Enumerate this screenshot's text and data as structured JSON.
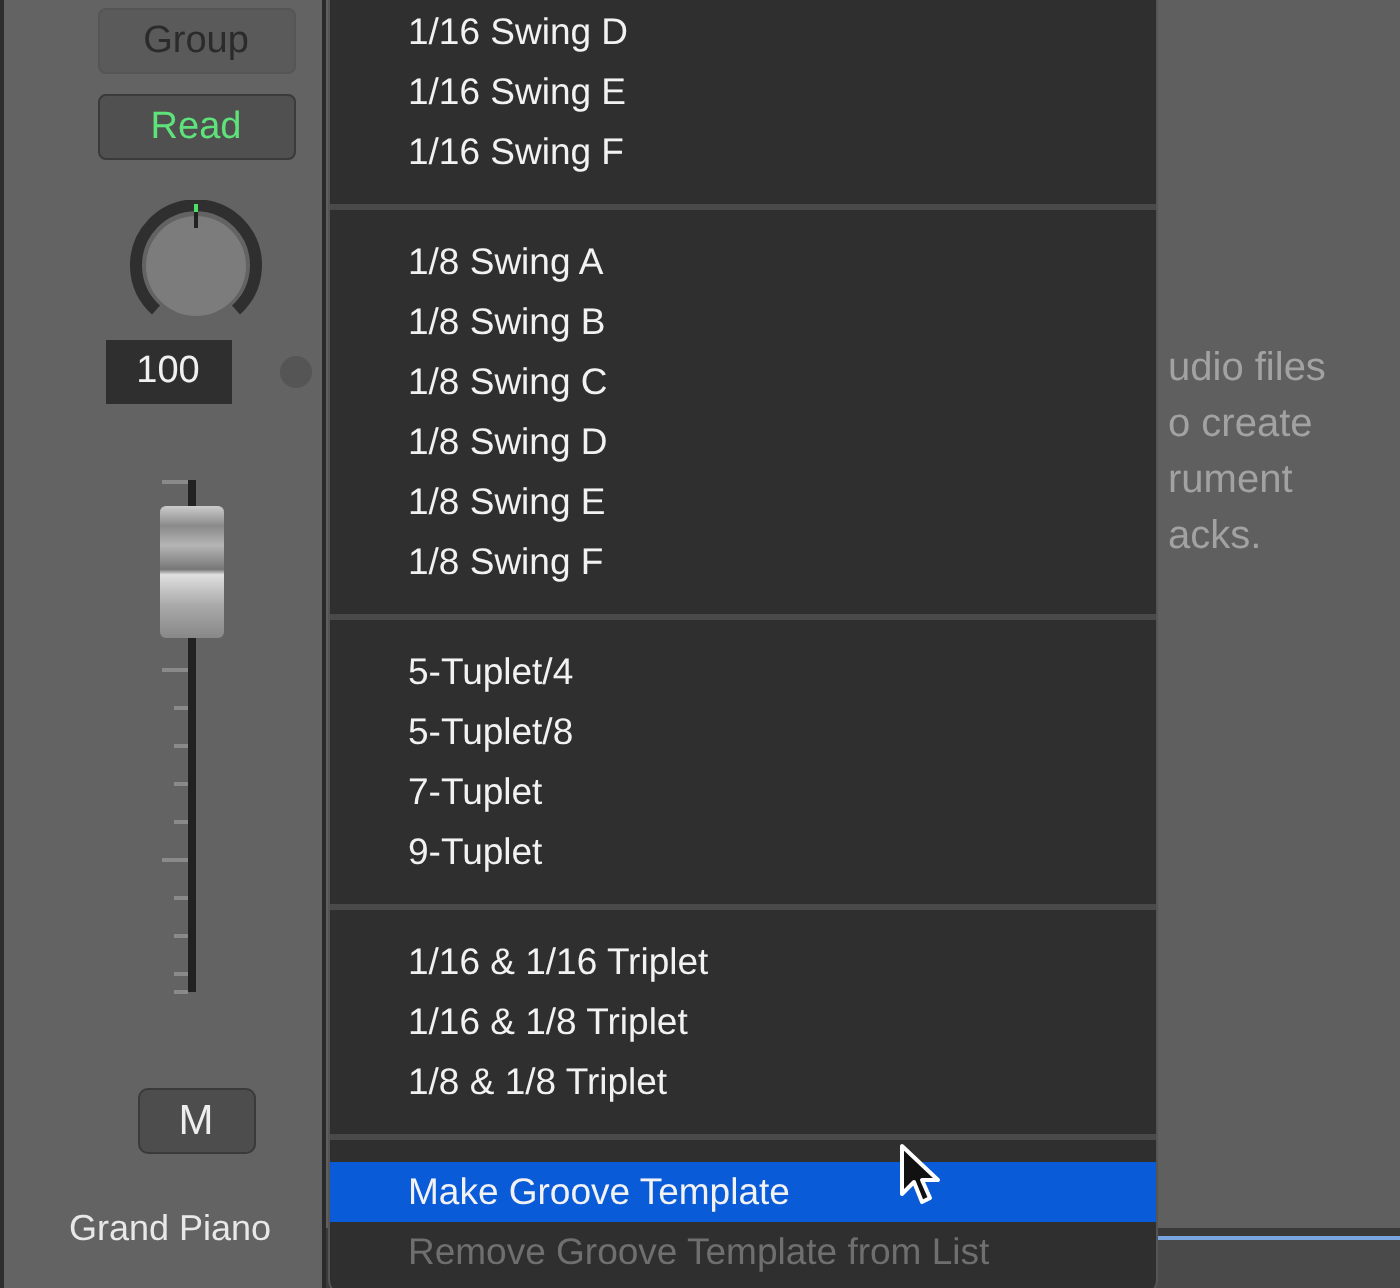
{
  "channel_strip": {
    "group_button": "Group",
    "automation_button": "Read",
    "pan_value": "100",
    "fader": {
      "level": 0.82
    },
    "mute_button": "M",
    "track_name": "Grand Piano"
  },
  "hint_text": [
    "udio files",
    "o create",
    "rument",
    "acks."
  ],
  "menu": {
    "sections": [
      [
        {
          "label": "1/16 Swing D",
          "selected": false,
          "disabled": false
        },
        {
          "label": "1/16 Swing E",
          "selected": false,
          "disabled": false
        },
        {
          "label": "1/16 Swing F",
          "selected": false,
          "disabled": false
        }
      ],
      [
        {
          "label": "1/8 Swing A",
          "selected": false,
          "disabled": false
        },
        {
          "label": "1/8 Swing B",
          "selected": false,
          "disabled": false
        },
        {
          "label": "1/8 Swing C",
          "selected": false,
          "disabled": false
        },
        {
          "label": "1/8 Swing D",
          "selected": false,
          "disabled": false
        },
        {
          "label": "1/8 Swing E",
          "selected": false,
          "disabled": false
        },
        {
          "label": "1/8 Swing F",
          "selected": false,
          "disabled": false
        }
      ],
      [
        {
          "label": "5-Tuplet/4",
          "selected": false,
          "disabled": false
        },
        {
          "label": "5-Tuplet/8",
          "selected": false,
          "disabled": false
        },
        {
          "label": "7-Tuplet",
          "selected": false,
          "disabled": false
        },
        {
          "label": "9-Tuplet",
          "selected": false,
          "disabled": false
        }
      ],
      [
        {
          "label": "1/16 & 1/16 Triplet",
          "selected": false,
          "disabled": false
        },
        {
          "label": "1/16 & 1/8 Triplet",
          "selected": false,
          "disabled": false
        },
        {
          "label": "1/8 & 1/8 Triplet",
          "selected": false,
          "disabled": false
        }
      ],
      [
        {
          "label": "Make Groove Template",
          "selected": true,
          "disabled": false
        },
        {
          "label": "Remove Groove Template from List",
          "selected": false,
          "disabled": true
        }
      ]
    ]
  }
}
